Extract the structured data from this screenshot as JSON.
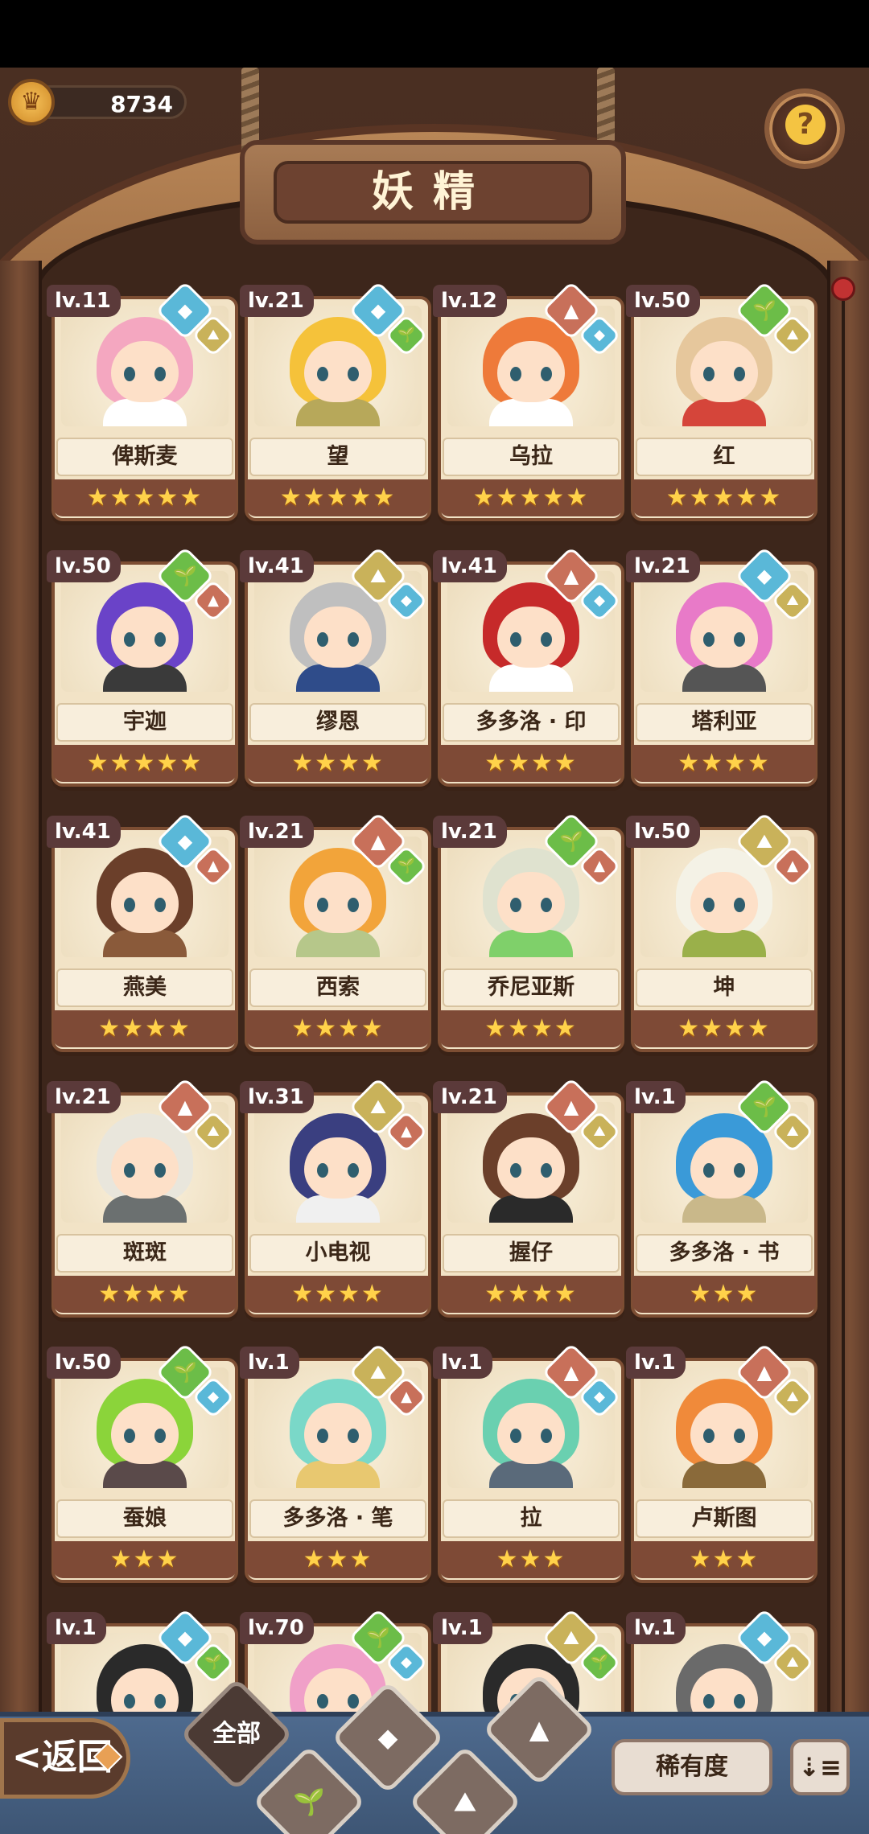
{
  "currency": {
    "icon": "crown-coin-icon",
    "value": "8734"
  },
  "help": {
    "icon": "question-sprout-icon",
    "glyph": "?"
  },
  "title": "妖精",
  "colors": {
    "water": "#5ab8d8",
    "earth": "#c9b25a",
    "fire": "#c8705a",
    "plant": "#6cbd48",
    "star": "#ffd24a"
  },
  "fairies": [
    {
      "level": "lv.11",
      "name": "俾斯麦",
      "stars": "★★★★★",
      "el1": "water",
      "el2": "earth",
      "hair": "#f4a7c0",
      "body": "#ffffff"
    },
    {
      "level": "lv.21",
      "name": "望",
      "stars": "★★★★★",
      "el1": "water",
      "el2": "plant",
      "hair": "#f5c23a",
      "body": "#b7a85a"
    },
    {
      "level": "lv.12",
      "name": "乌拉",
      "stars": "★★★★★",
      "el1": "fire",
      "el2": "water",
      "hair": "#ee7a3a",
      "body": "#ffffff"
    },
    {
      "level": "lv.50",
      "name": "红",
      "stars": "★★★★★",
      "el1": "plant",
      "el2": "earth",
      "hair": "#e6c79c",
      "body": "#d5453a"
    },
    {
      "level": "lv.50",
      "name": "宇迦",
      "stars": "★★★★★",
      "el1": "plant",
      "el2": "fire",
      "hair": "#6a43c8",
      "body": "#3a3a3a"
    },
    {
      "level": "lv.41",
      "name": "缪恩",
      "stars": "★★★★",
      "el1": "earth",
      "el2": "water",
      "hair": "#bfbfbf",
      "body": "#2f4c8a"
    },
    {
      "level": "lv.41",
      "name": "多多洛 · 印",
      "stars": "★★★★",
      "el1": "fire",
      "el2": "water",
      "hair": "#c62a2a",
      "body": "#ffffff"
    },
    {
      "level": "lv.21",
      "name": "塔利亚",
      "stars": "★★★★",
      "el1": "water",
      "el2": "earth",
      "hair": "#e87ac8",
      "body": "#555555"
    },
    {
      "level": "lv.41",
      "name": "燕美",
      "stars": "★★★★",
      "el1": "water",
      "el2": "fire",
      "hair": "#6b3f2a",
      "body": "#8a5a3a"
    },
    {
      "level": "lv.21",
      "name": "西索",
      "stars": "★★★★",
      "el1": "fire",
      "el2": "plant",
      "hair": "#f2a43a",
      "body": "#b6c78a"
    },
    {
      "level": "lv.21",
      "name": "乔尼亚斯",
      "stars": "★★★★",
      "el1": "plant",
      "el2": "fire",
      "hair": "#dfe2cf",
      "body": "#7fd06a"
    },
    {
      "level": "lv.50",
      "name": "坤",
      "stars": "★★★★",
      "el1": "earth",
      "el2": "fire",
      "hair": "#f4f2e6",
      "body": "#9ab04a"
    },
    {
      "level": "lv.21",
      "name": "斑斑",
      "stars": "★★★★",
      "el1": "fire",
      "el2": "earth",
      "hair": "#e9e6dc",
      "body": "#6b7070"
    },
    {
      "level": "lv.31",
      "name": "小电视",
      "stars": "★★★★",
      "el1": "earth",
      "el2": "fire",
      "hair": "#3a3f80",
      "body": "#f0f0f0"
    },
    {
      "level": "lv.21",
      "name": "握仔",
      "stars": "★★★★",
      "el1": "fire",
      "el2": "earth",
      "hair": "#6b3f2a",
      "body": "#2a2a2a"
    },
    {
      "level": "lv.1",
      "name": "多多洛 · 书",
      "stars": "★★★",
      "el1": "plant",
      "el2": "earth",
      "hair": "#3a9ad8",
      "body": "#c9b88a"
    },
    {
      "level": "lv.50",
      "name": "蚕娘",
      "stars": "★★★",
      "el1": "plant",
      "el2": "water",
      "hair": "#8bd43a",
      "body": "#5a4a4a"
    },
    {
      "level": "lv.1",
      "name": "多多洛 · 笔",
      "stars": "★★★",
      "el1": "earth",
      "el2": "fire",
      "hair": "#7ad8c8",
      "body": "#e8c870"
    },
    {
      "level": "lv.1",
      "name": "拉",
      "stars": "★★★",
      "el1": "fire",
      "el2": "water",
      "hair": "#6ad0b0",
      "body": "#5a6a7a"
    },
    {
      "level": "lv.1",
      "name": "卢斯图",
      "stars": "★★★",
      "el1": "fire",
      "el2": "earth",
      "hair": "#f08a3a",
      "body": "#8a6a3a"
    },
    {
      "level": "lv.1",
      "name": "",
      "stars": "",
      "el1": "water",
      "el2": "plant",
      "hair": "#2a2a2a",
      "body": "#c8b8a8"
    },
    {
      "level": "lv.70",
      "name": "",
      "stars": "",
      "el1": "plant",
      "el2": "water",
      "hair": "#f0a0c8",
      "body": "#f0e0d0"
    },
    {
      "level": "lv.1",
      "name": "",
      "stars": "",
      "el1": "earth",
      "el2": "plant",
      "hair": "#2a2a2a",
      "body": "#8a6a4a"
    },
    {
      "level": "lv.1",
      "name": "",
      "stars": "",
      "el1": "water",
      "el2": "earth",
      "hair": "#6a6a6a",
      "body": "#4ab0e8"
    }
  ],
  "bottom": {
    "back_label": "返回",
    "back_arrow": "<",
    "filters": [
      {
        "key": "all",
        "label": "全部",
        "glyph": "全部"
      },
      {
        "key": "plant",
        "label": "plant-filter",
        "glyph": "🌱"
      },
      {
        "key": "water",
        "label": "water-filter",
        "glyph": "◆"
      },
      {
        "key": "earth",
        "label": "earth-filter",
        "glyph": "⛰"
      },
      {
        "key": "fire",
        "label": "fire-filter",
        "glyph": "▲"
      }
    ],
    "sort_label": "稀有度",
    "sort_order_glyph": "⇣≡"
  }
}
